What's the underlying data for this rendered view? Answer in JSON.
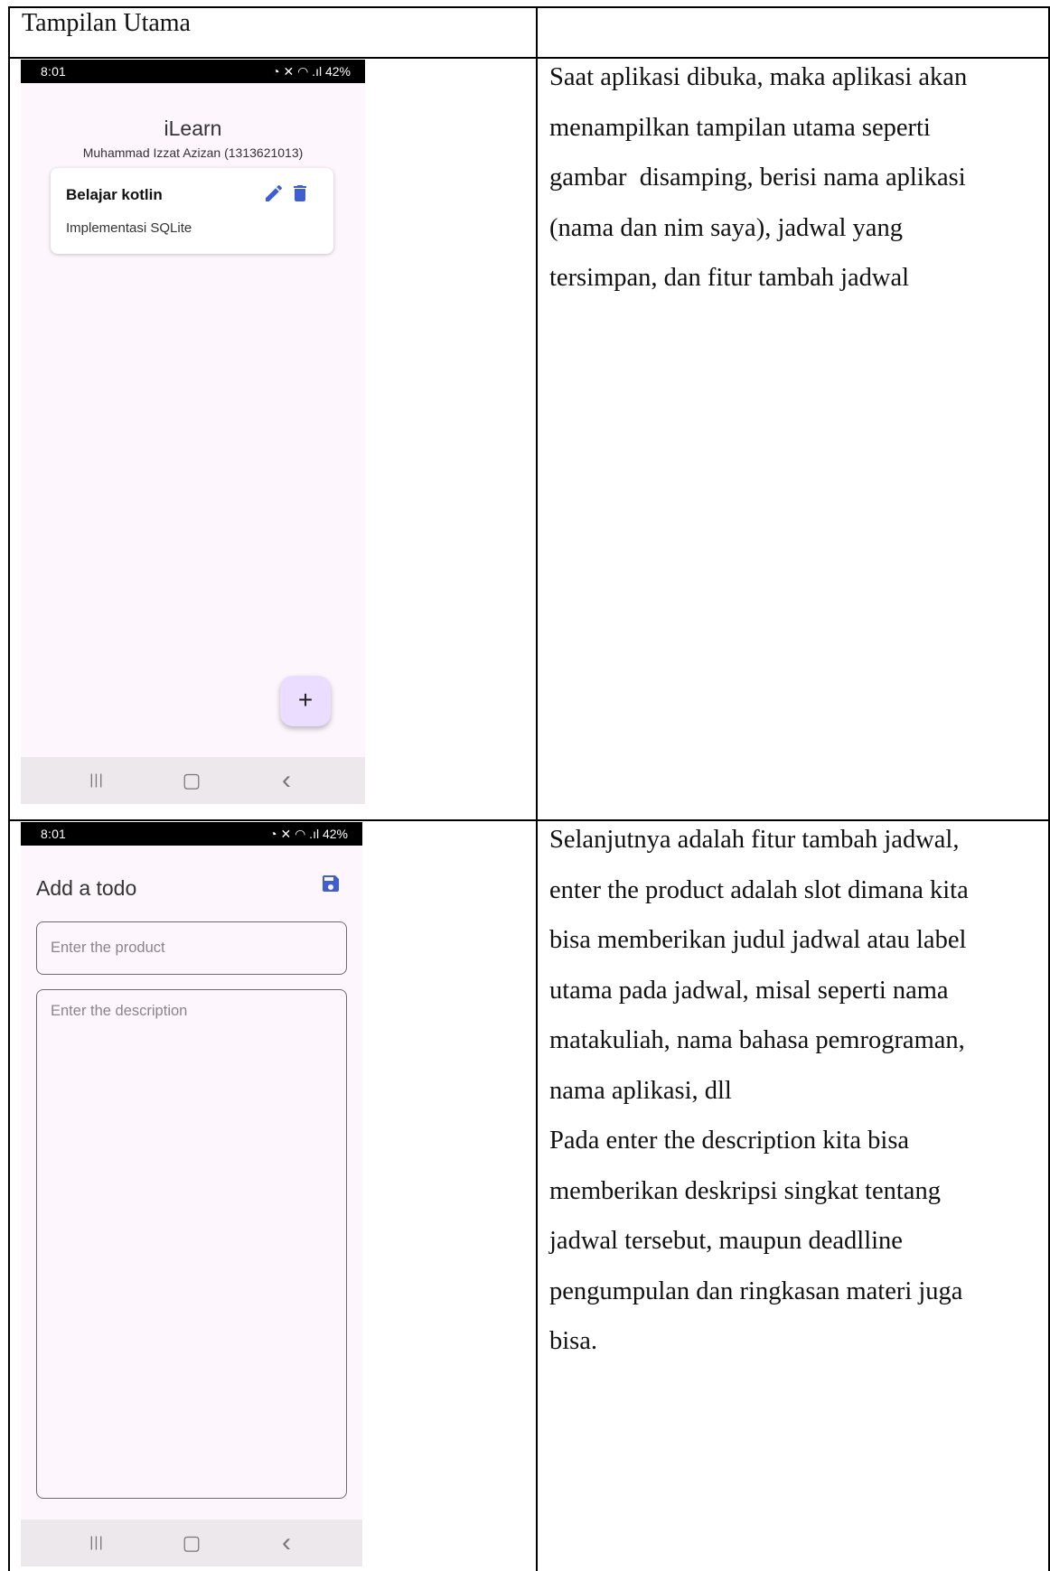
{
  "table": {
    "header_cell": "Tampilan Utama",
    "row1_description": [
      "Saat aplikasi dibuka, maka aplikasi akan",
      "menampilkan tampilan utama seperti",
      "gambar  disamping, berisi nama aplikasi",
      "(nama dan nim saya), jadwal yang",
      "tersimpan, dan fitur tambah jadwal"
    ],
    "row2_description": [
      "Selanjutnya adalah fitur tambah jadwal,",
      "enter the product adalah slot dimana kita",
      "bisa memberikan judul jadwal atau label",
      "utama pada jadwal, misal seperti nama",
      "matakuliah, nama bahasa pemrograman,",
      "nama aplikasi, dll",
      "Pada enter the description kita bisa",
      "memberikan deskripsi singkat tentang",
      "jadwal tersebut, maupun deadlline",
      "pengumpulan dan ringkasan materi juga",
      "bisa."
    ]
  },
  "phone1": {
    "status_time": "8:01",
    "status_battery": "42%",
    "app_name": "iLearn",
    "subtitle": "Muhammad Izzat Azizan (1313621013)",
    "card": {
      "title": "Belajar kotlin",
      "description": "Implementasi SQLite"
    },
    "fab_label": "+",
    "accent_color": "#3f5fd0"
  },
  "phone2": {
    "status_time": "8:01",
    "status_battery": "42%",
    "screen_title": "Add a todo",
    "product_placeholder": "Enter the product",
    "description_placeholder": "Enter the description"
  },
  "navbar": {
    "recent_icon": "|||",
    "home_icon": "▢",
    "back_icon": "‹"
  }
}
